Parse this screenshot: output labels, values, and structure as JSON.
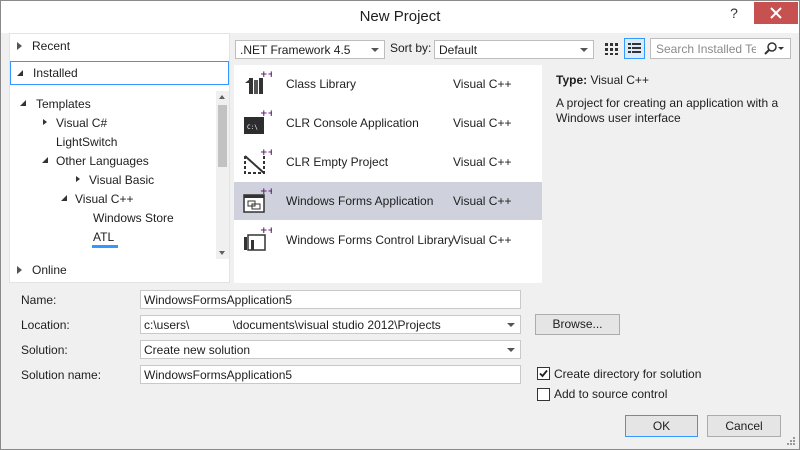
{
  "window": {
    "title": "New Project",
    "help_label": "?"
  },
  "nav": {
    "recent": "Recent",
    "installed": "Installed",
    "online": "Online",
    "tree": [
      {
        "label": "Templates"
      },
      {
        "label": "Visual C#"
      },
      {
        "label": "LightSwitch"
      },
      {
        "label": "Other Languages"
      },
      {
        "label": "Visual Basic"
      },
      {
        "label": "Visual C++"
      },
      {
        "label": "Windows Store"
      },
      {
        "label": "ATL"
      }
    ]
  },
  "toolbar": {
    "framework": ".NET Framework 4.5",
    "sort_label": "Sort by:",
    "sort_value": "Default",
    "search_placeholder": "Search Installed Te"
  },
  "templates": [
    {
      "name": "Class Library",
      "lang": "Visual C++",
      "icon": "class-library-icon"
    },
    {
      "name": "CLR Console Application",
      "lang": "Visual C++",
      "icon": "console-app-icon"
    },
    {
      "name": "CLR Empty Project",
      "lang": "Visual C++",
      "icon": "empty-project-icon"
    },
    {
      "name": "Windows Forms Application",
      "lang": "Visual C++",
      "icon": "forms-app-icon",
      "selected": true
    },
    {
      "name": "Windows Forms Control Library",
      "lang": "Visual C++",
      "icon": "forms-control-library-icon"
    }
  ],
  "details": {
    "type_label": "Type:",
    "type_value": "Visual C++",
    "description": "A project for creating an application with a Windows user interface"
  },
  "form": {
    "name_label": "Name:",
    "name_value": "WindowsFormsApplication5",
    "location_label": "Location:",
    "location_value": "c:\\users\\             \\documents\\visual studio 2012\\Projects",
    "browse_label": "Browse...",
    "solution_label": "Solution:",
    "solution_value": "Create new solution",
    "solution_name_label": "Solution name:",
    "solution_name_value": "WindowsFormsApplication5",
    "create_dir_label": "Create directory for solution",
    "create_dir_checked": true,
    "source_control_label": "Add to source control",
    "source_control_checked": false,
    "ok_label": "OK",
    "cancel_label": "Cancel"
  },
  "colors": {
    "accent": "#3399ff",
    "close": "#c75050",
    "selection": "#cfd1dd",
    "cpp": "#68217a"
  }
}
